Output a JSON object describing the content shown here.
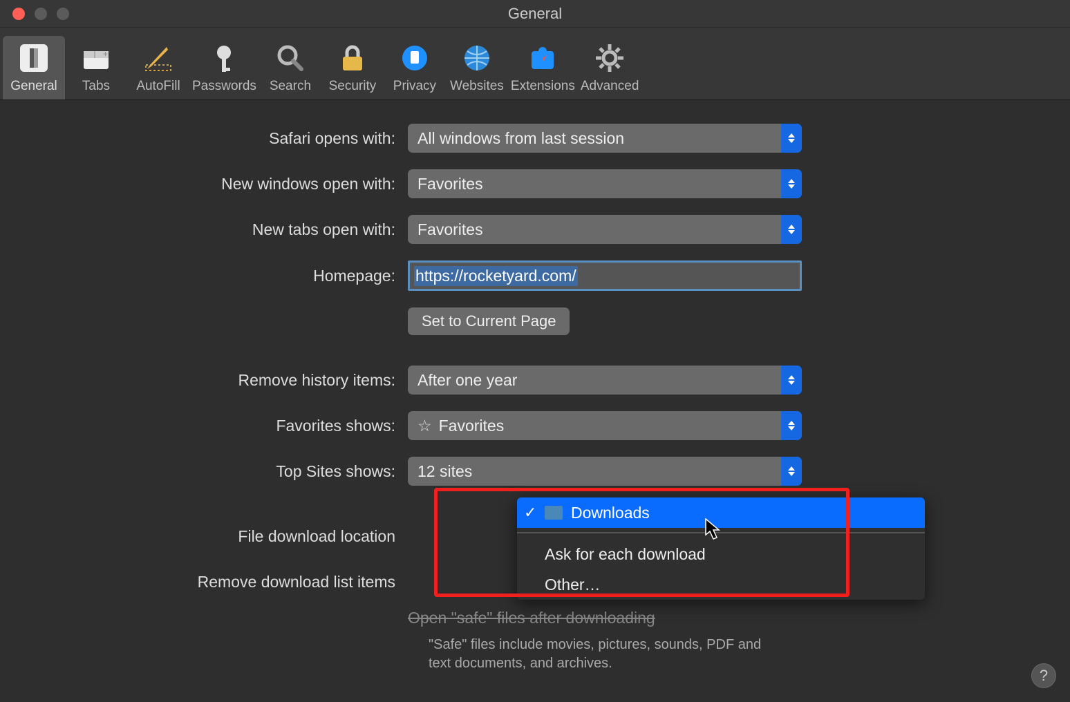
{
  "window": {
    "title": "General"
  },
  "toolbar": {
    "items": [
      {
        "label": "General"
      },
      {
        "label": "Tabs"
      },
      {
        "label": "AutoFill"
      },
      {
        "label": "Passwords"
      },
      {
        "label": "Search"
      },
      {
        "label": "Security"
      },
      {
        "label": "Privacy"
      },
      {
        "label": "Websites"
      },
      {
        "label": "Extensions"
      },
      {
        "label": "Advanced"
      }
    ]
  },
  "form": {
    "safari_opens_with": {
      "label": "Safari opens with:",
      "value": "All windows from last session"
    },
    "new_windows": {
      "label": "New windows open with:",
      "value": "Favorites"
    },
    "new_tabs": {
      "label": "New tabs open with:",
      "value": "Favorites"
    },
    "homepage": {
      "label": "Homepage:",
      "value": "https://rocketyard.com/"
    },
    "set_current": "Set to Current Page",
    "remove_history": {
      "label": "Remove history items:",
      "value": "After one year"
    },
    "favorites_shows": {
      "label": "Favorites shows:",
      "value": "Favorites"
    },
    "topsites_shows": {
      "label": "Top Sites shows:",
      "value": "12 sites"
    },
    "download_location": {
      "label": "File download location"
    },
    "remove_downloads": {
      "label": "Remove download list items"
    },
    "open_safe": {
      "label": "Open \"safe\" files after downloading"
    },
    "safe_note": "\"Safe\" files include movies, pictures, sounds, PDF and text documents, and archives."
  },
  "popup": {
    "selected": "Downloads",
    "items": [
      "Ask for each download",
      "Other…"
    ]
  },
  "help": "?"
}
